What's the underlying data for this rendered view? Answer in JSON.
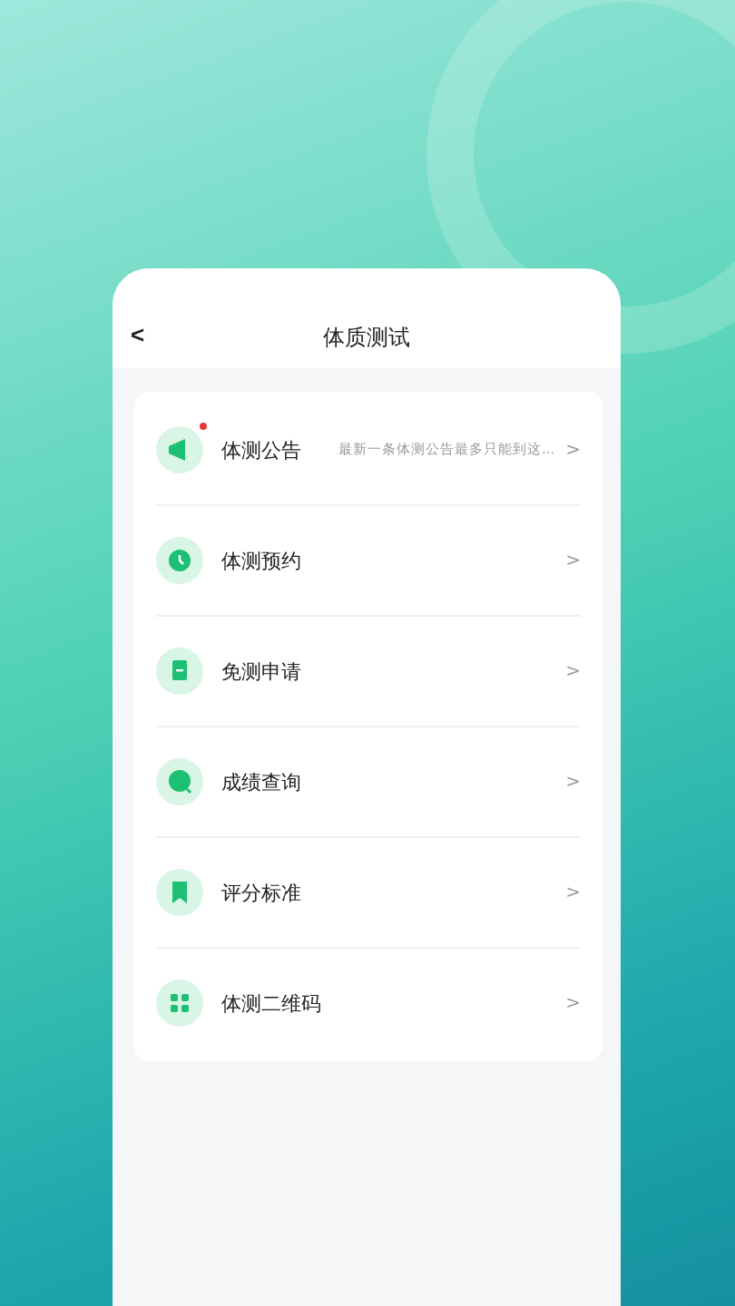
{
  "header": {
    "back": "<",
    "title": "体质测试"
  },
  "items": [
    {
      "label": "体测公告",
      "unread": true,
      "detail": "最新一条体测公告最多只能到这...",
      "chevron": ">"
    },
    {
      "label": "体测预约",
      "unread": false,
      "chevron": ">"
    },
    {
      "label": "免测申请",
      "unread": false,
      "chevron": ">"
    },
    {
      "label": "成绩查询",
      "unread": false,
      "chevron": ">"
    },
    {
      "label": "评分标准",
      "unread": false,
      "chevron": ">"
    },
    {
      "label": "体测二维码",
      "unread": false,
      "chevron": ">"
    }
  ]
}
